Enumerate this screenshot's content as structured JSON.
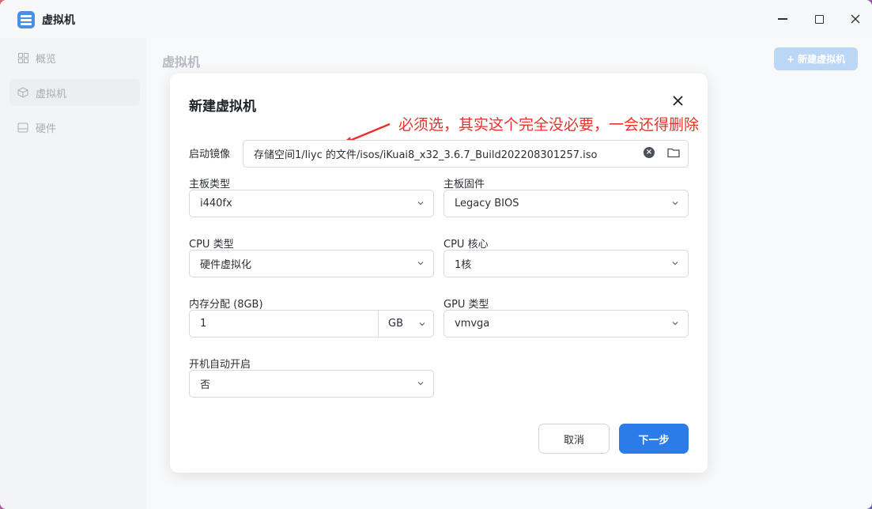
{
  "window": {
    "title": "虚拟机"
  },
  "sidebar": {
    "items": [
      {
        "label": "概览",
        "icon": "grid-icon"
      },
      {
        "label": "虚拟机",
        "icon": "cube-icon"
      },
      {
        "label": "硬件",
        "icon": "drive-icon"
      }
    ]
  },
  "main": {
    "page_title": "虚拟机",
    "new_button": "+ 新建虚拟机"
  },
  "dialog": {
    "title": "新建虚拟机",
    "annotation": "必须选，其实这个完全没必要，一会还得删除",
    "boot_image": {
      "label": "启动镜像",
      "value": "存储空间1/liyc 的文件/isos/iKuai8_x32_3.6.7_Build202208301257.iso"
    },
    "board_type": {
      "label": "主板类型",
      "value": "i440fx"
    },
    "firmware": {
      "label": "主板固件",
      "value": "Legacy BIOS"
    },
    "cpu_type": {
      "label": "CPU 类型",
      "value": "硬件虚拟化"
    },
    "cpu_cores": {
      "label": "CPU 核心",
      "value": "1核"
    },
    "memory": {
      "label": "内存分配 (8GB)",
      "value": "1",
      "unit": "GB"
    },
    "gpu_type": {
      "label": "GPU 类型",
      "value": "vmvga"
    },
    "autostart": {
      "label": "开机自动开启",
      "value": "否"
    },
    "cancel_label": "取消",
    "next_label": "下一步"
  },
  "colors": {
    "accent": "#2b7ce9",
    "annotation": "#e8322b"
  }
}
